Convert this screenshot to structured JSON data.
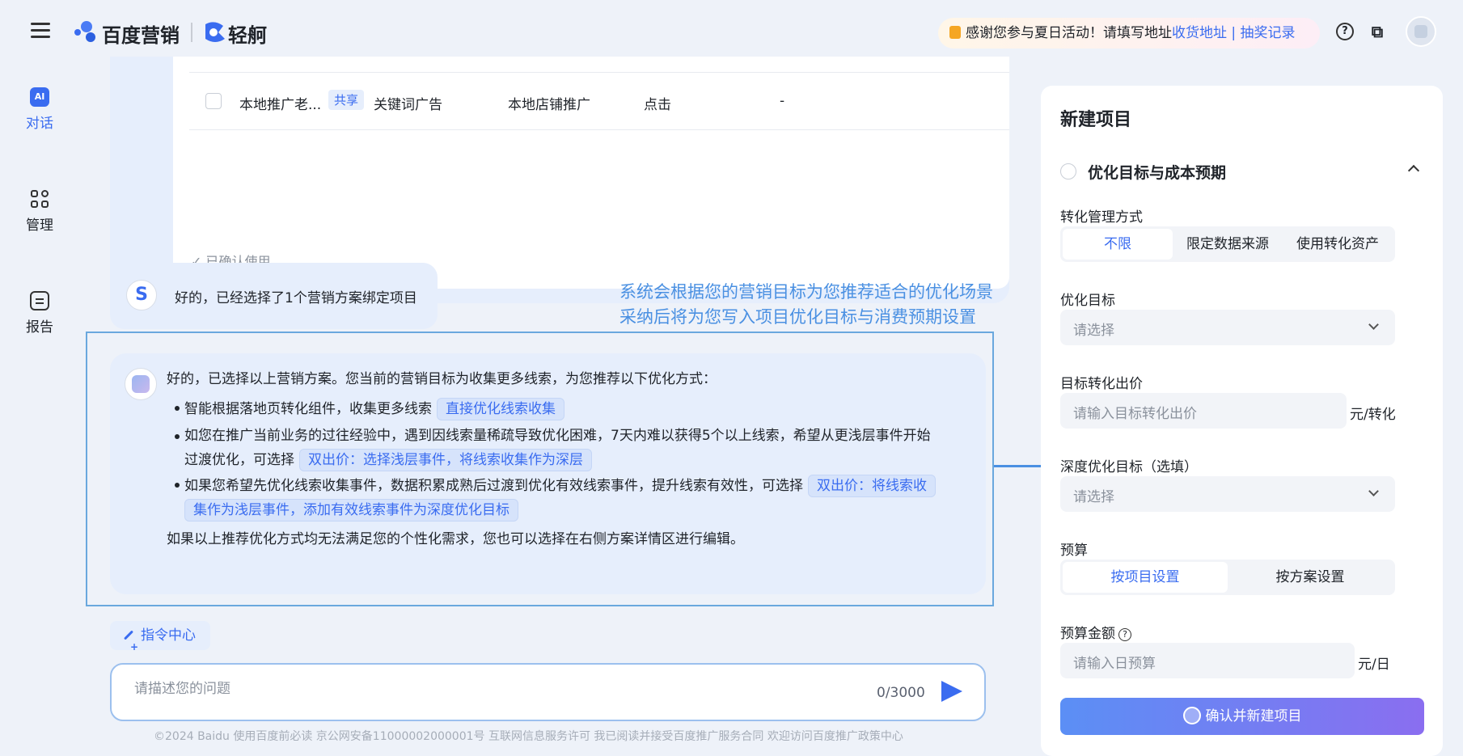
{
  "header": {
    "brand_primary": "百度营销",
    "brand_secondary": "轻舸",
    "notice_text": "感谢您参与夏日活动！请填写地址",
    "notice_link1": "收货地址",
    "notice_sep": "|",
    "notice_link2": "抽奖记录",
    "help_glyph": "?",
    "copy_glyph": "⧉"
  },
  "nav": {
    "items": [
      {
        "label": "对话",
        "icon": "ai-chat-icon",
        "icon_text": "AI"
      },
      {
        "label": "管理",
        "icon": "grid-icon"
      },
      {
        "label": "报告",
        "icon": "report-icon"
      }
    ]
  },
  "plan_table": {
    "row": {
      "name": "本地推广老...",
      "tag": "共享",
      "type": "关键词广告",
      "scene": "本地店铺推广",
      "bid": "点击",
      "extra": "-"
    },
    "confirmed_label": "✓ 已确认使用"
  },
  "chat": {
    "user_avatar": "S",
    "user_reply": "好的，已经选择了1个营销方案绑定项目",
    "annotation_line1": "系统会根据您的营销目标为您推荐适合的优化场景",
    "annotation_line2": "采纳后将为您写入项目优化目标与消费预期设置",
    "ai_intro": "好的，已选择以上营销方案。您当前的营销目标为收集更多线索，为您推荐以下优化方式：",
    "bullet1_text": "智能根据落地页转化组件，收集更多线索",
    "bullet1_chip": "直接优化线索收集",
    "bullet2_line1": "如您在推广当前业务的过往经验中，遇到因线索量稀疏导致优化困难，7天内难以获得5个以上线索，希望从更浅层事件开始",
    "bullet2_line2": "过渡优化，可选择",
    "bullet2_chip": "双出价：选择浅层事件，将线索收集作为深层",
    "bullet3_line1": "如果您希望先优化线索收集事件，数据积累成熟后过渡到优化有效线索事件，提升线索有效性，可选择",
    "bullet3_chip1": "双出价：将线索收",
    "bullet3_chip2": "集作为浅层事件，添加有效线索事件为深度优化目标",
    "ai_outro": "如果以上推荐优化方式均无法满足您的个性化需求，您也可以选择在右侧方案详情区进行编辑。",
    "command_center": "指令中心",
    "input_placeholder": "请描述您的问题",
    "counter": "0/3000"
  },
  "footer": "©2024 Baidu 使用百度前必读 京公网安备11000002000001号 互联网信息服务许可 我已阅读并接受百度推广服务合同 欢迎访问百度推广政策中心",
  "panel": {
    "title": "新建项目",
    "section_title": "优化目标与成本预期",
    "conv_label": "转化管理方式",
    "conv_options": [
      "不限",
      "限定数据来源",
      "使用转化资产"
    ],
    "opt_goal_label": "优化目标",
    "opt_goal_placeholder": "请选择",
    "target_bid_label": "目标转化出价",
    "target_bid_placeholder": "请输入目标转化出价",
    "target_bid_unit": "元/转化",
    "deep_goal_label": "深度优化目标（选填）",
    "deep_goal_placeholder": "请选择",
    "budget_label": "预算",
    "budget_options": [
      "按项目设置",
      "按方案设置"
    ],
    "budget_amount_label": "预算金额",
    "budget_amount_placeholder": "请输入日预算",
    "budget_unit": "元/日",
    "confirm_button": "确认并新建项目"
  },
  "colors": {
    "accent": "#3a6cf0",
    "annotation": "#4a90e2",
    "bubble": "#e6eefc"
  }
}
